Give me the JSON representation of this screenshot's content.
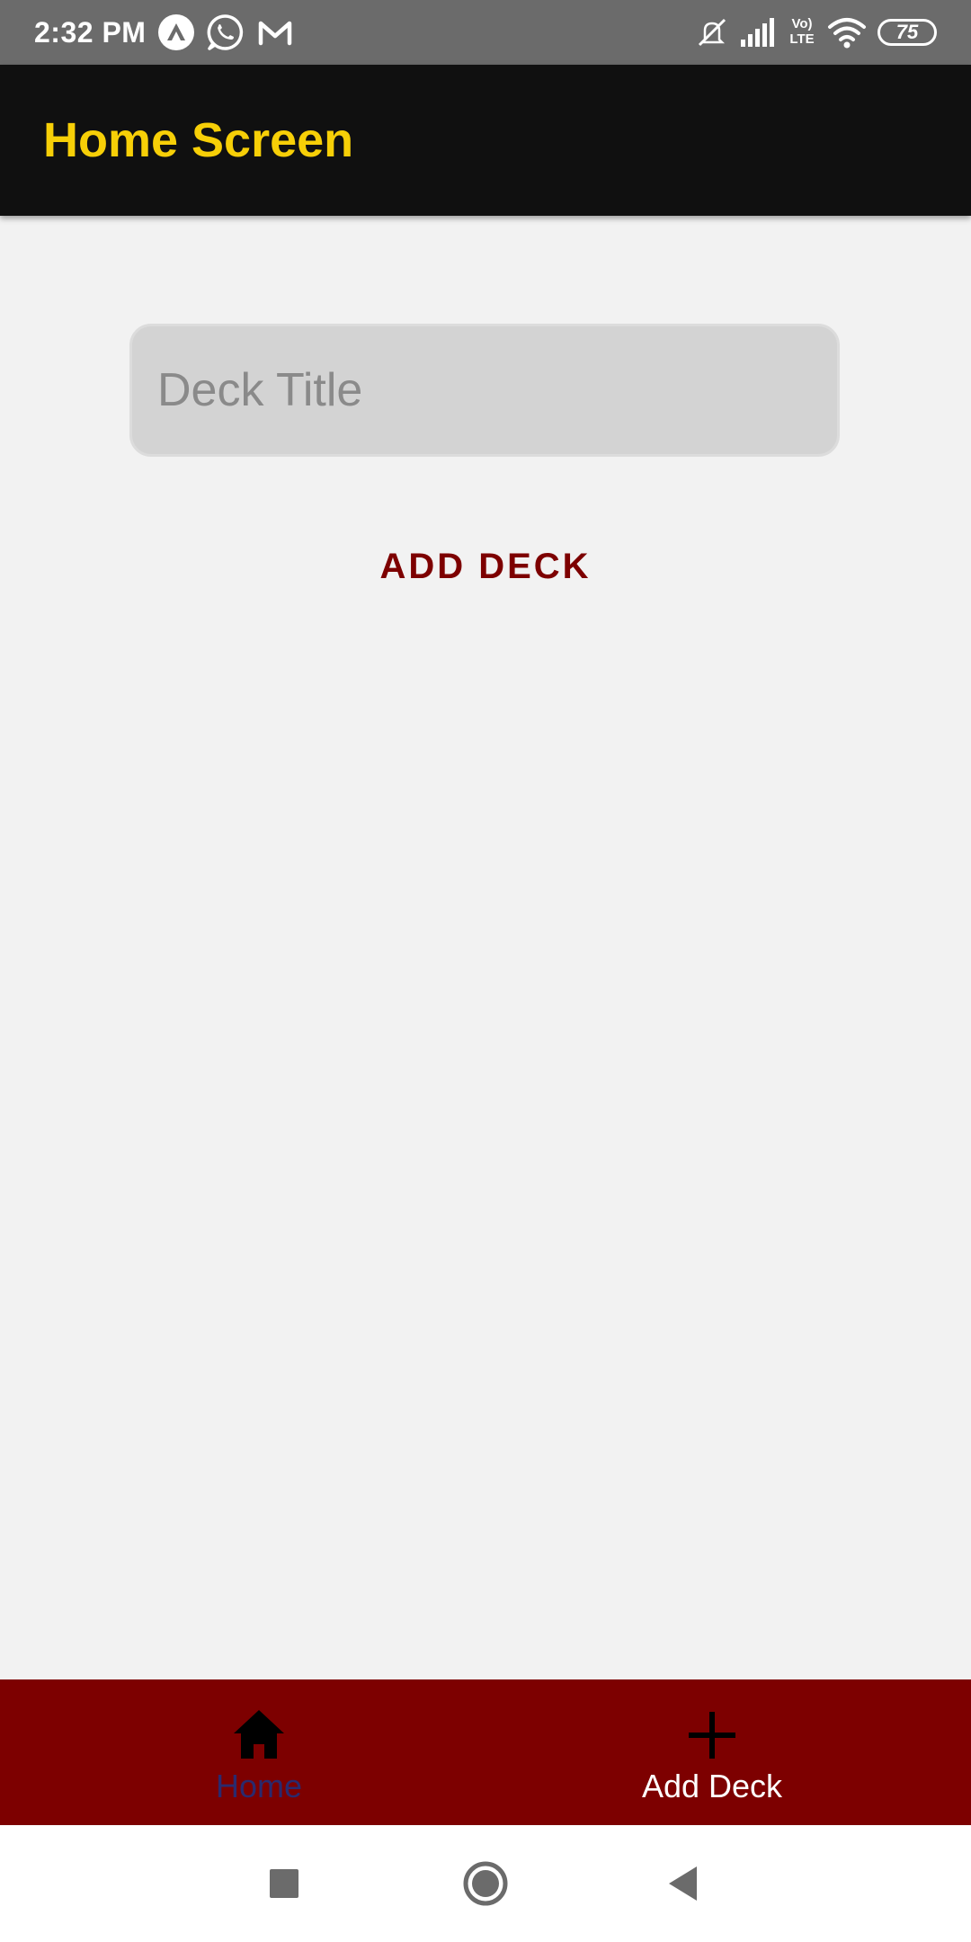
{
  "status_bar": {
    "time": "2:32 PM",
    "battery": "75",
    "network_label_top": "Vo)",
    "network_label_bottom": "LTE",
    "left_icons": [
      "arc-icon",
      "whatsapp-icon",
      "gmail-icon"
    ],
    "right_icons": [
      "silent-icon",
      "signal-icon",
      "volte-icon",
      "wifi-icon",
      "battery-icon"
    ]
  },
  "app_bar": {
    "title": "Home Screen",
    "title_color": "#f7cf07",
    "background": "#101010"
  },
  "form": {
    "deck_title_placeholder": "Deck Title",
    "deck_title_value": "",
    "add_button_label": "ADD DECK",
    "add_button_color": "#7d0000"
  },
  "tab_bar": {
    "background": "#7d0000",
    "tabs": [
      {
        "label": "Home",
        "icon": "home-icon",
        "label_color": "#2a2a6e",
        "active": true
      },
      {
        "label": "Add Deck",
        "icon": "plus-icon",
        "label_color": "#ffffff",
        "active": false
      }
    ]
  },
  "nav_bar": {
    "buttons": [
      "recents-button",
      "home-button",
      "back-button"
    ]
  }
}
